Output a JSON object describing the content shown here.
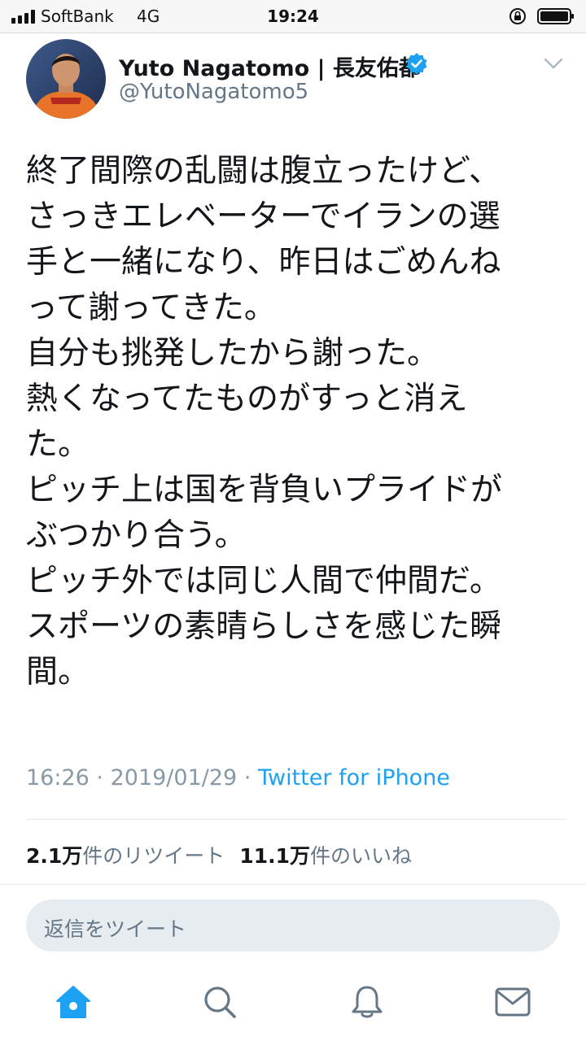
{
  "status_bar": {
    "carrier": "SoftBank",
    "network": "4G",
    "time": "19:24"
  },
  "tweet": {
    "display_name": "Yuto Nagatomo | 長友佑都",
    "username": "@YutoNagatomo5",
    "verified": true,
    "text_lines": [
      "終了間際の乱闘は腹立ったけど、",
      "さっきエレベーターでイランの選",
      "手と一緒になり、昨日はごめんね",
      "って謝ってきた。",
      "自分も挑発したから謝った。",
      "熱くなってたものがすっと消え",
      "た。",
      "ピッチ上は国を背負いプライドが",
      "ぶつかり合う。",
      "ピッチ外では同じ人間で仲間だ。",
      "スポーツの素晴らしさを感じた瞬",
      "間。"
    ],
    "time": "16:26",
    "date": "2019/01/29",
    "separator": "·",
    "source": "Twitter for iPhone"
  },
  "stats": {
    "retweets_count": "2.1万",
    "retweets_label": "件のリツイート",
    "likes_count": "11.1万",
    "likes_label": "件のいいね"
  },
  "reply": {
    "placeholder": "返信をツイート"
  },
  "tab_bar": {
    "tabs": [
      {
        "icon": "home-icon",
        "active": true
      },
      {
        "icon": "search-icon",
        "active": false
      },
      {
        "icon": "notifications-bell-icon",
        "active": false
      },
      {
        "icon": "messages-envelope-icon",
        "active": false
      }
    ]
  },
  "colors": {
    "accent": "#1da1f2",
    "text": "#14171a",
    "muted": "#657786",
    "meta": "#8899a6",
    "reply_bg": "#e6ecf0",
    "tab_inactive": "#657786"
  }
}
